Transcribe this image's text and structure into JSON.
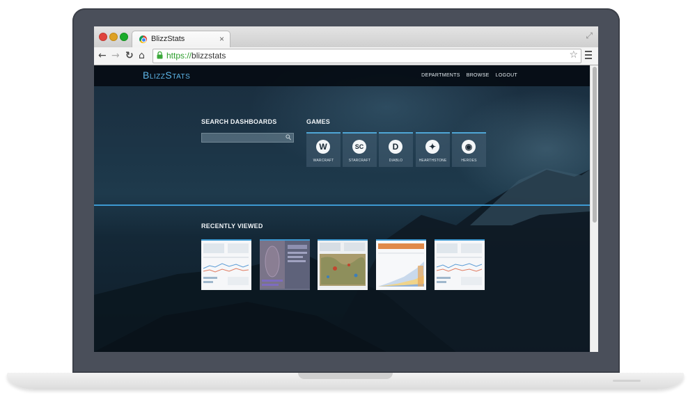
{
  "browser": {
    "tab_title": "BlizzStats",
    "tab_close": "×",
    "url_scheme": "https://",
    "url_host": "blizzstats",
    "back_glyph": "←",
    "forward_glyph": "→",
    "reload_glyph": "↻",
    "home_glyph": "⌂",
    "star_glyph": "☆",
    "fullscreen_glyph": "⤢"
  },
  "site": {
    "logo": "BlizzStats",
    "nav": [
      "DEPARTMENTS",
      "BROWSE",
      "LOGOUT"
    ]
  },
  "search": {
    "title": "SEARCH DASHBOARDS",
    "value": ""
  },
  "games": {
    "title": "GAMES",
    "items": [
      {
        "label": "WARCRAFT",
        "glyph": "W",
        "icon": "warcraft-icon"
      },
      {
        "label": "STARCRAFT",
        "glyph": "SC",
        "icon": "starcraft-icon"
      },
      {
        "label": "DIABLO",
        "glyph": "D",
        "icon": "diablo-icon"
      },
      {
        "label": "HEARTHSTONE",
        "glyph": "✦",
        "icon": "hearthstone-icon"
      },
      {
        "label": "HEROES",
        "glyph": "◉",
        "icon": "heroes-icon"
      }
    ]
  },
  "recent": {
    "title": "RECENTLY VIEWED",
    "count": 5
  },
  "colors": {
    "accent": "#3e9ad2",
    "logo": "#5eb6e8",
    "header": "#050c14"
  }
}
